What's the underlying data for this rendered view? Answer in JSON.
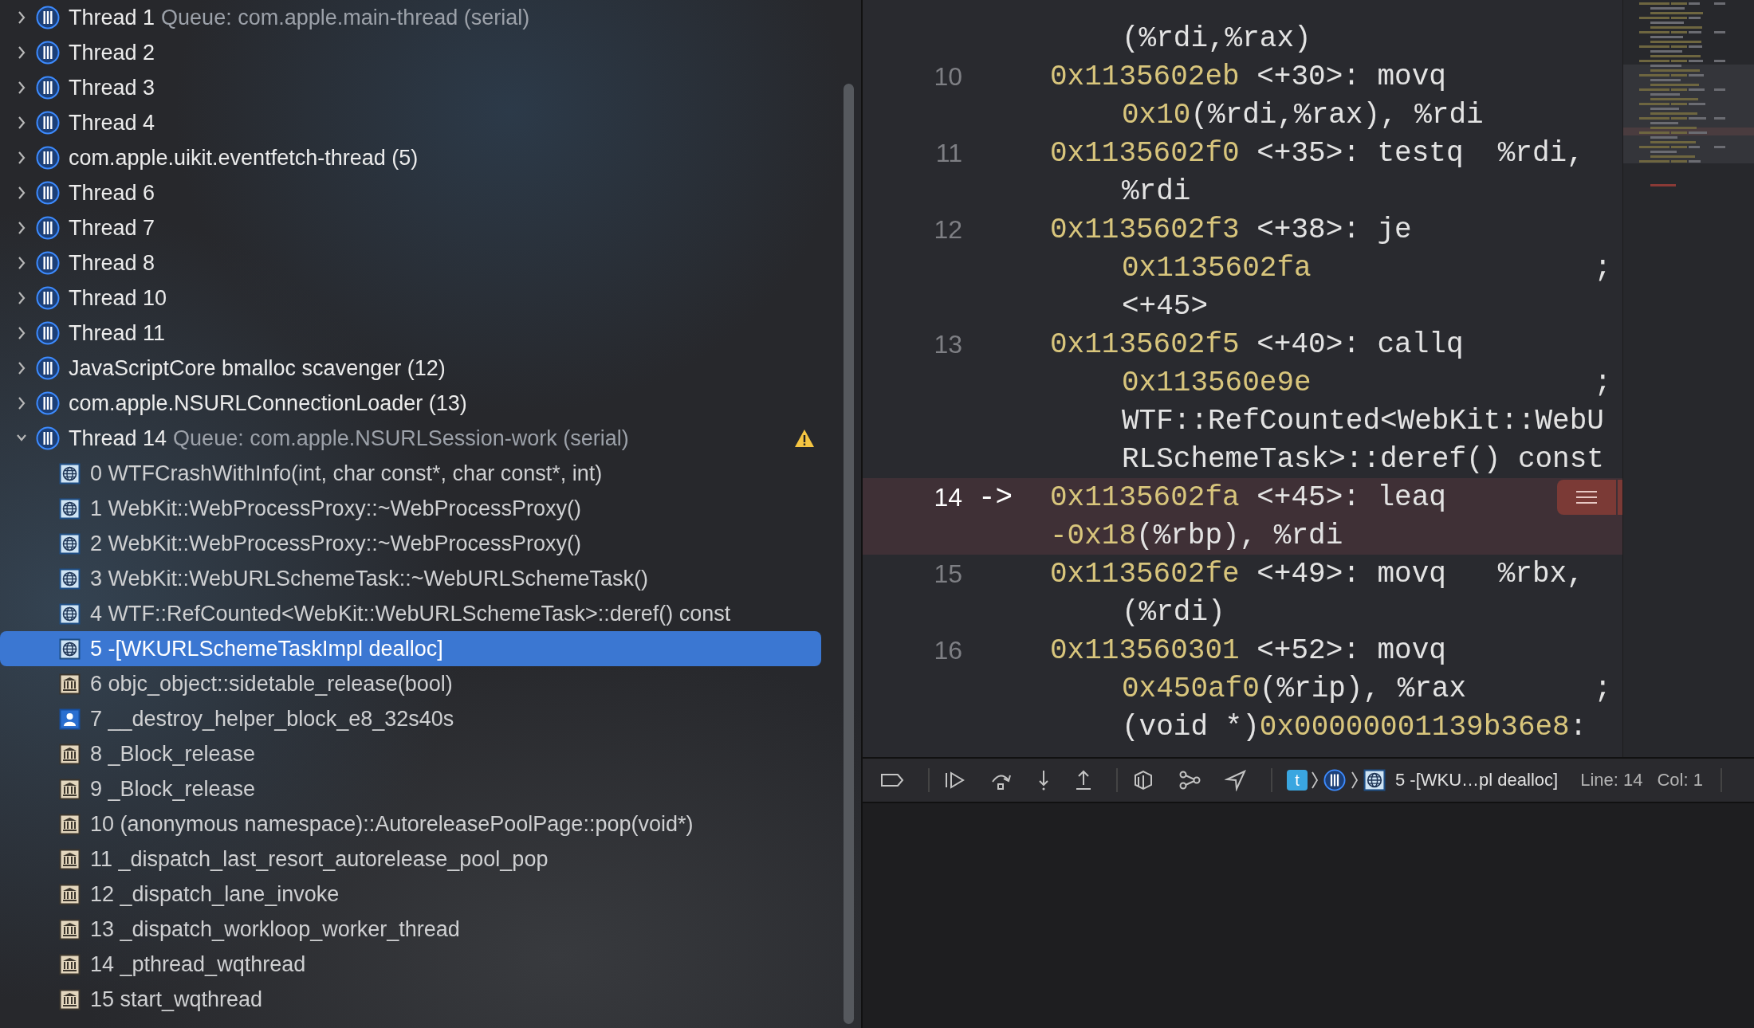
{
  "threads": [
    {
      "name": "Thread 1",
      "queue": "Queue: com.apple.main-thread (serial)",
      "expanded": false,
      "warning": false
    },
    {
      "name": "Thread 2",
      "expanded": false,
      "warning": false
    },
    {
      "name": "Thread 3",
      "expanded": false,
      "warning": false
    },
    {
      "name": "Thread 4",
      "expanded": false,
      "warning": false
    },
    {
      "name": "com.apple.uikit.eventfetch-thread (5)",
      "expanded": false,
      "warning": false
    },
    {
      "name": "Thread 6",
      "expanded": false,
      "warning": false
    },
    {
      "name": "Thread 7",
      "expanded": false,
      "warning": false
    },
    {
      "name": "Thread 8",
      "expanded": false,
      "warning": false
    },
    {
      "name": "Thread 10",
      "expanded": false,
      "warning": false
    },
    {
      "name": "Thread 11",
      "expanded": false,
      "warning": false
    },
    {
      "name": "JavaScriptCore bmalloc scavenger (12)",
      "expanded": false,
      "warning": false
    },
    {
      "name": "com.apple.NSURLConnectionLoader (13)",
      "expanded": false,
      "warning": false
    },
    {
      "name": "Thread 14",
      "queue": "Queue: com.apple.NSURLSession-work (serial)",
      "expanded": true,
      "warning": true,
      "frames": [
        {
          "label": "0 WTFCrashWithInfo(int, char const*, char const*, int)",
          "kind": "globe",
          "selected": false
        },
        {
          "label": "1 WebKit::WebProcessProxy::~WebProcessProxy()",
          "kind": "globe",
          "selected": false
        },
        {
          "label": "2 WebKit::WebProcessProxy::~WebProcessProxy()",
          "kind": "globe",
          "selected": false
        },
        {
          "label": "3 WebKit::WebURLSchemeTask::~WebURLSchemeTask()",
          "kind": "globe",
          "selected": false
        },
        {
          "label": "4 WTF::RefCounted<WebKit::WebURLSchemeTask>::deref() const",
          "kind": "globe",
          "selected": false
        },
        {
          "label": "5 -[WKURLSchemeTaskImpl dealloc]",
          "kind": "globe",
          "selected": true
        },
        {
          "label": "6 objc_object::sidetable_release(bool)",
          "kind": "library",
          "selected": false
        },
        {
          "label": "7 __destroy_helper_block_e8_32s40s",
          "kind": "user",
          "selected": false
        },
        {
          "label": "8 _Block_release",
          "kind": "library",
          "selected": false
        },
        {
          "label": "9 _Block_release",
          "kind": "library",
          "selected": false
        },
        {
          "label": "10 (anonymous namespace)::AutoreleasePoolPage::pop(void*)",
          "kind": "library",
          "selected": false
        },
        {
          "label": "11 _dispatch_last_resort_autorelease_pool_pop",
          "kind": "library",
          "selected": false
        },
        {
          "label": "12 _dispatch_lane_invoke",
          "kind": "library",
          "selected": false
        },
        {
          "label": "13 _dispatch_workloop_worker_thread",
          "kind": "library",
          "selected": false
        },
        {
          "label": "14 _pthread_wqthread",
          "kind": "library",
          "selected": false
        },
        {
          "label": "15 start_wqthread",
          "kind": "library",
          "selected": false
        }
      ]
    }
  ],
  "code": {
    "instructions": [
      {
        "current": false,
        "wrapped": [
          [
            {
              "kind": "text",
              "text": "(%rdi,%rax)"
            }
          ]
        ]
      },
      {
        "line": "10",
        "current": false,
        "head": [
          {
            "kind": "hex",
            "text": "0x1135602eb"
          },
          {
            "kind": "text",
            "text": " <+30>: movq"
          }
        ],
        "wrapped": [
          [
            {
              "kind": "hex",
              "text": "0x10"
            },
            {
              "kind": "text",
              "text": "(%rdi,%rax), %rdi"
            }
          ]
        ]
      },
      {
        "line": "11",
        "current": false,
        "head": [
          {
            "kind": "hex",
            "text": "0x1135602f0"
          },
          {
            "kind": "text",
            "text": " <+35>: testq  %rdi,"
          }
        ],
        "wrapped": [
          [
            {
              "kind": "text",
              "text": "%rdi"
            }
          ]
        ]
      },
      {
        "line": "12",
        "current": false,
        "head": [
          {
            "kind": "hex",
            "text": "0x1135602f3"
          },
          {
            "kind": "text",
            "text": " <+38>: je"
          }
        ],
        "wrapped": [
          [
            {
              "kind": "hex",
              "text": "0x1135602fa"
            },
            {
              "kind": "tail",
              "text": ";"
            }
          ],
          [
            {
              "kind": "text",
              "text": "<+45>"
            }
          ]
        ]
      },
      {
        "line": "13",
        "current": false,
        "head": [
          {
            "kind": "hex",
            "text": "0x1135602f5"
          },
          {
            "kind": "text",
            "text": " <+40>: callq"
          }
        ],
        "wrapped": [
          [
            {
              "kind": "hex",
              "text": "0x113560e9e"
            },
            {
              "kind": "tail",
              "text": ";"
            }
          ],
          [
            {
              "kind": "text",
              "text": "WTF::RefCounted<WebKit::WebU"
            }
          ],
          [
            {
              "kind": "text",
              "text": "RLSchemeTask>::deref() const"
            }
          ]
        ]
      },
      {
        "line": "14",
        "current": true,
        "pointer": "->",
        "head": [
          {
            "kind": "hex",
            "text": "0x1135602fa"
          },
          {
            "kind": "text",
            "text": " <+45>: leaq"
          }
        ],
        "wrapped": [
          [
            {
              "kind": "hex",
              "text": "-0x18"
            },
            {
              "kind": "text",
              "text": "(%rbp), %rdi"
            }
          ]
        ]
      },
      {
        "line": "15",
        "current": false,
        "head": [
          {
            "kind": "hex",
            "text": "0x1135602fe"
          },
          {
            "kind": "text",
            "text": " <+49>: movq   %rbx,"
          }
        ],
        "wrapped": [
          [
            {
              "kind": "text",
              "text": "(%rdi)"
            }
          ]
        ]
      },
      {
        "line": "16",
        "current": false,
        "head": [
          {
            "kind": "hex",
            "text": "0x113560301"
          },
          {
            "kind": "text",
            "text": " <+52>: movq"
          }
        ],
        "wrapped": [
          [
            {
              "kind": "hex",
              "text": "0x450af0"
            },
            {
              "kind": "text",
              "text": "(%rip), %rax"
            },
            {
              "kind": "tail",
              "text": ";"
            }
          ],
          [
            {
              "kind": "text",
              "text": "(void *)"
            },
            {
              "kind": "hex",
              "text": "0x00000001139b36e8"
            },
            {
              "kind": "text",
              "text": ":"
            }
          ]
        ]
      }
    ]
  },
  "debug_bar": {
    "app_badge": "t",
    "breadcrumb": "5 -[WKU…pl dealloc]",
    "line": "Line: 14",
    "column": "Col: 1"
  }
}
